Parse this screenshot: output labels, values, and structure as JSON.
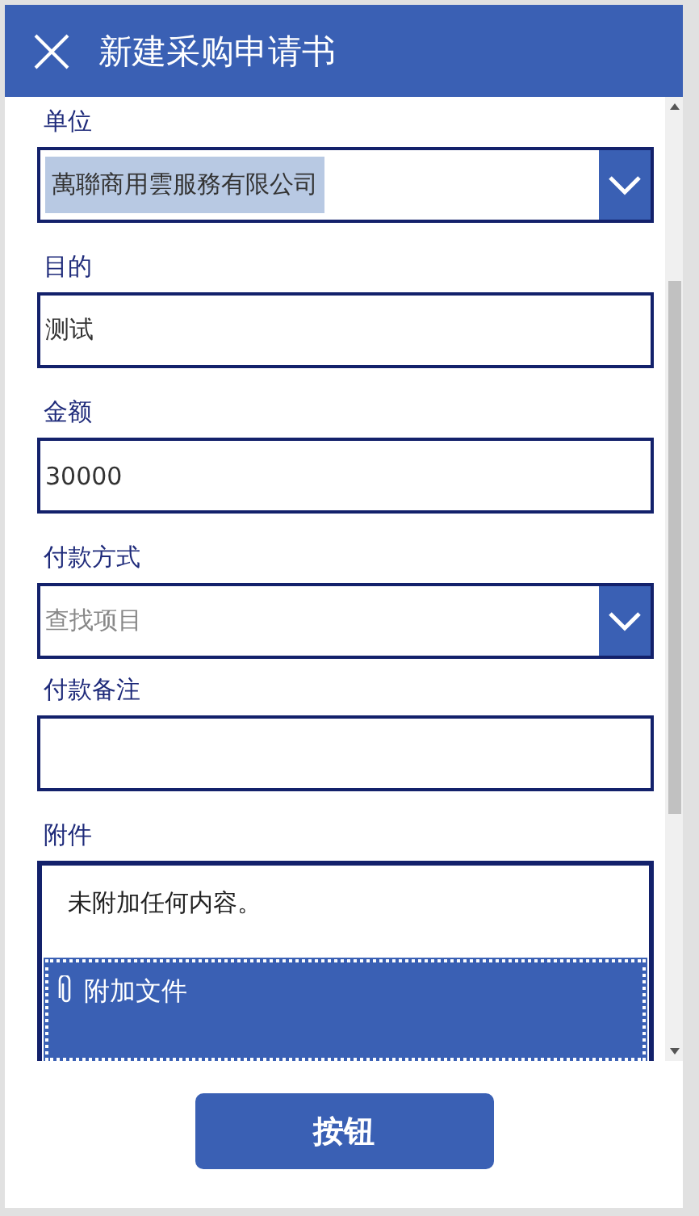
{
  "header": {
    "title": "新建采购申请书"
  },
  "fields": [
    {
      "kind": "dropdown",
      "label": "单位",
      "value": "萬聯商用雲服務有限公司",
      "value_highlighted": true
    },
    {
      "kind": "text",
      "label": "目的",
      "value": "测试"
    },
    {
      "kind": "text",
      "label": "金额",
      "value": "30000"
    },
    {
      "kind": "dropdown",
      "label": "付款方式",
      "placeholder": "查找项目"
    },
    {
      "kind": "text",
      "label": "付款备注"
    },
    {
      "kind": "attachment",
      "label": "附件",
      "empty_text": "未附加任何内容。",
      "attach_label": "附加文件"
    }
  ],
  "button": "按钮"
}
